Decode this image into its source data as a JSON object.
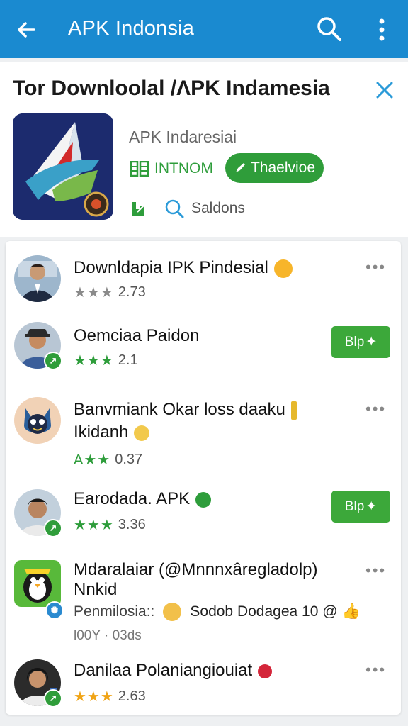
{
  "appbar": {
    "title": "APK Indonsia"
  },
  "card": {
    "heading": "Tor Downloolal /ΛPK Indamesia",
    "developer": "APK Indaresiai",
    "info_label": "INTNOM",
    "install_label": "Thaelvioe",
    "meta_label": "Saldons"
  },
  "list": [
    {
      "name": "Downldapia IPK Pindesial",
      "stars": "★★★",
      "rating": "2.73",
      "action": "more"
    },
    {
      "name": "Oemciaa Paidon",
      "stars": "★★★",
      "rating": "2.1",
      "action": "button",
      "button_label": "Blp"
    },
    {
      "name": "Banvmiank Okar loss daaku",
      "name_line2": "Ikidanh",
      "stars": "A★★",
      "rating": "0.37",
      "action": "more"
    },
    {
      "name": "Earodada. APK",
      "stars": "★★★",
      "rating": "3.36",
      "action": "button",
      "button_label": "Blp"
    },
    {
      "name": "Mdaralaiar (@Mnnnxâregladolp)",
      "name_line2": "Nnkid",
      "sub": "Penmilosia::",
      "sub2": "Sodob Dodagea 10 @",
      "footer": "l00Y · 03ds",
      "action": "more"
    },
    {
      "name": "Danilaa Polaniangiouiat",
      "stars": "★★★",
      "rating": "2.63",
      "action": "more"
    }
  ]
}
